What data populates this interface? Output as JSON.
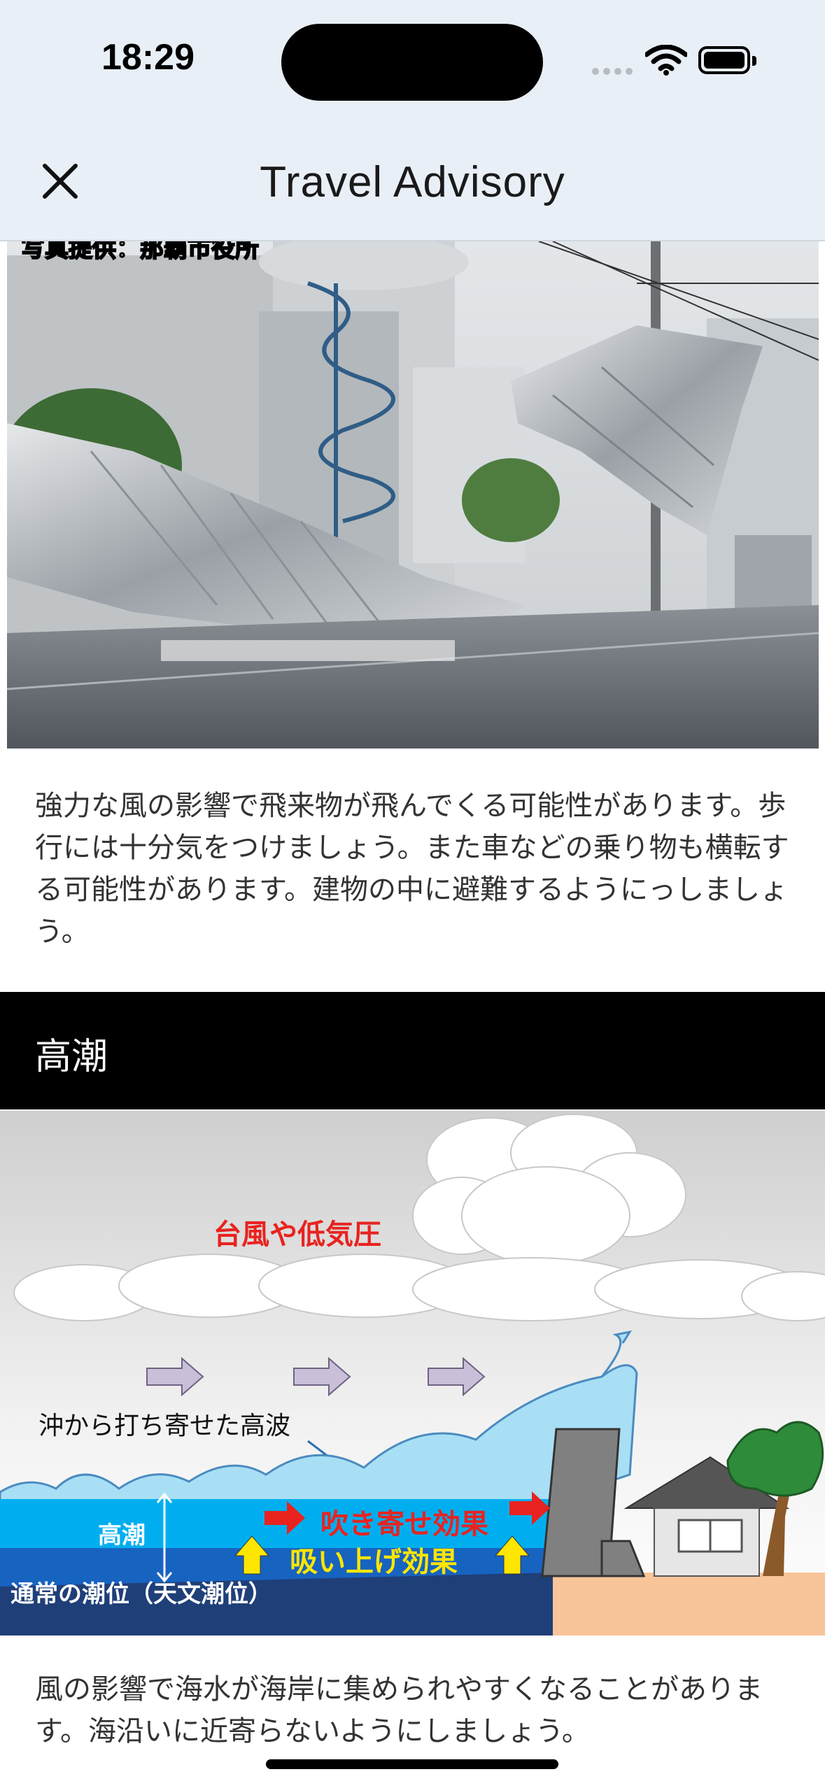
{
  "status": {
    "time": "18:29"
  },
  "nav": {
    "title": "Travel Advisory"
  },
  "photo": {
    "credit": "写真提供：那覇市役所"
  },
  "wind": {
    "text": "強力な風の影響で飛来物が飛んでくる可能性があります。歩行には十分気をつけましょう。また車などの乗り物も横転する可能性があります。建物の中に避難するようにっしましょう。"
  },
  "surge": {
    "title": "高潮",
    "diagram": {
      "cloud_label": "台風や低気圧",
      "wave_label": "沖から打ち寄せた高波",
      "tide_label": "高潮",
      "blowin_label": "吹き寄せ効果",
      "suction_label": "吸い上げ効果",
      "normal_label": "通常の潮位（天文潮位）"
    },
    "text": "風の影響で海水が海岸に集められやすくなることがあります。海沿いに近寄らないようにしましょう。"
  },
  "colors": {
    "header_bg": "#e9eff6",
    "section_bg": "#000000",
    "red_label": "#e8231f",
    "sea": "#00aeef",
    "deep_sea": "#1f3f78",
    "sand": "#f8c49a"
  }
}
